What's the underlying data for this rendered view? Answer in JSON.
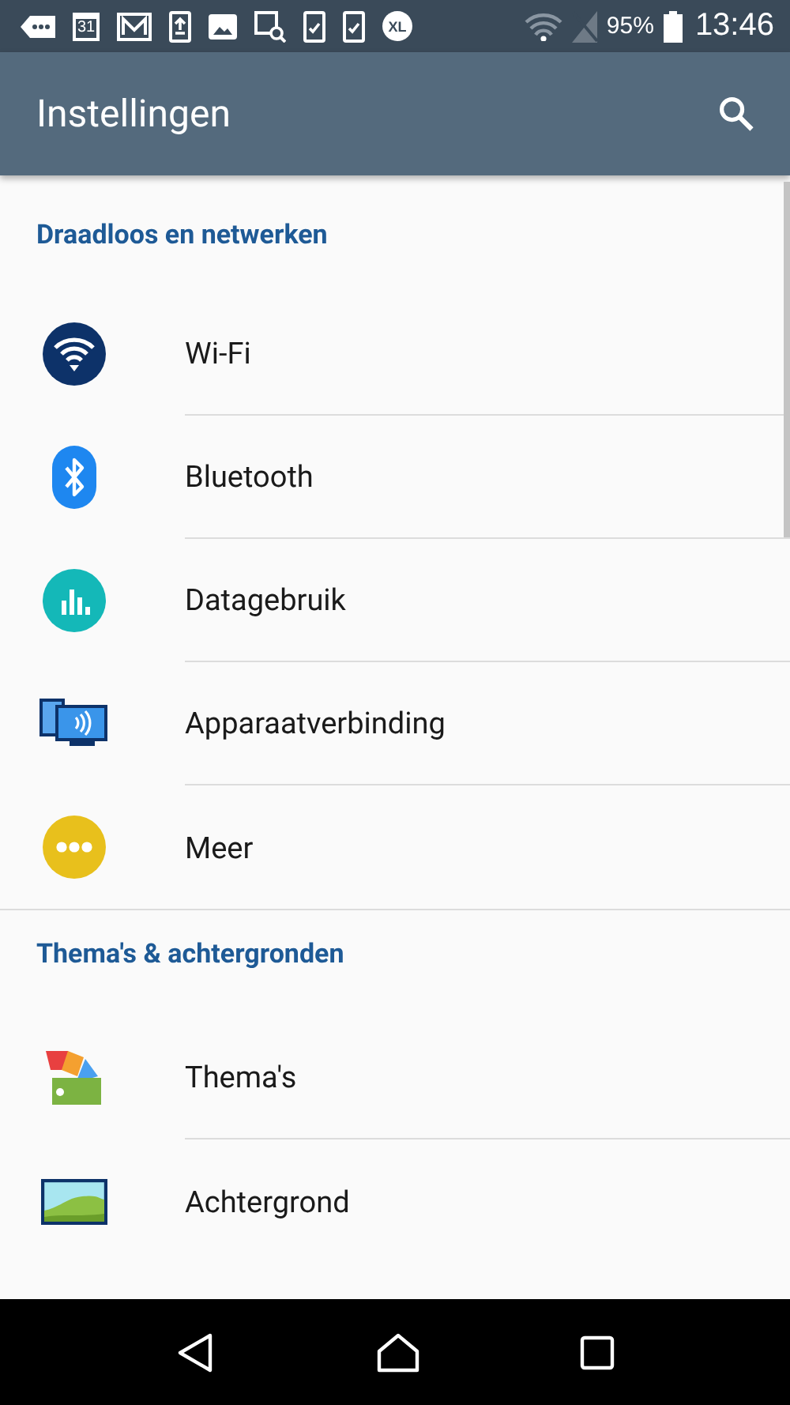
{
  "status_bar": {
    "notifications": [
      {
        "kind": "more"
      },
      {
        "kind": "calendar",
        "label": "31"
      },
      {
        "kind": "mail"
      },
      {
        "kind": "upload"
      },
      {
        "kind": "image"
      },
      {
        "kind": "search-doc"
      },
      {
        "kind": "check"
      },
      {
        "kind": "check"
      },
      {
        "kind": "xl",
        "label": "XL"
      }
    ],
    "battery_text": "95%",
    "time": "13:46"
  },
  "app_bar": {
    "title": "Instellingen"
  },
  "sections": [
    {
      "title": "Draadloos en netwerken",
      "items": [
        {
          "label": "Wi-Fi",
          "kind": "wifi"
        },
        {
          "label": "Bluetooth",
          "kind": "bluetooth"
        },
        {
          "label": "Datagebruik",
          "kind": "data"
        },
        {
          "label": "Apparaatverbinding",
          "kind": "device"
        },
        {
          "label": "Meer",
          "kind": "more"
        }
      ]
    },
    {
      "title": "Thema's & achtergronden",
      "items": [
        {
          "label": "Thema's",
          "kind": "themes"
        },
        {
          "label": "Achtergrond",
          "kind": "wallpaper"
        }
      ]
    }
  ]
}
